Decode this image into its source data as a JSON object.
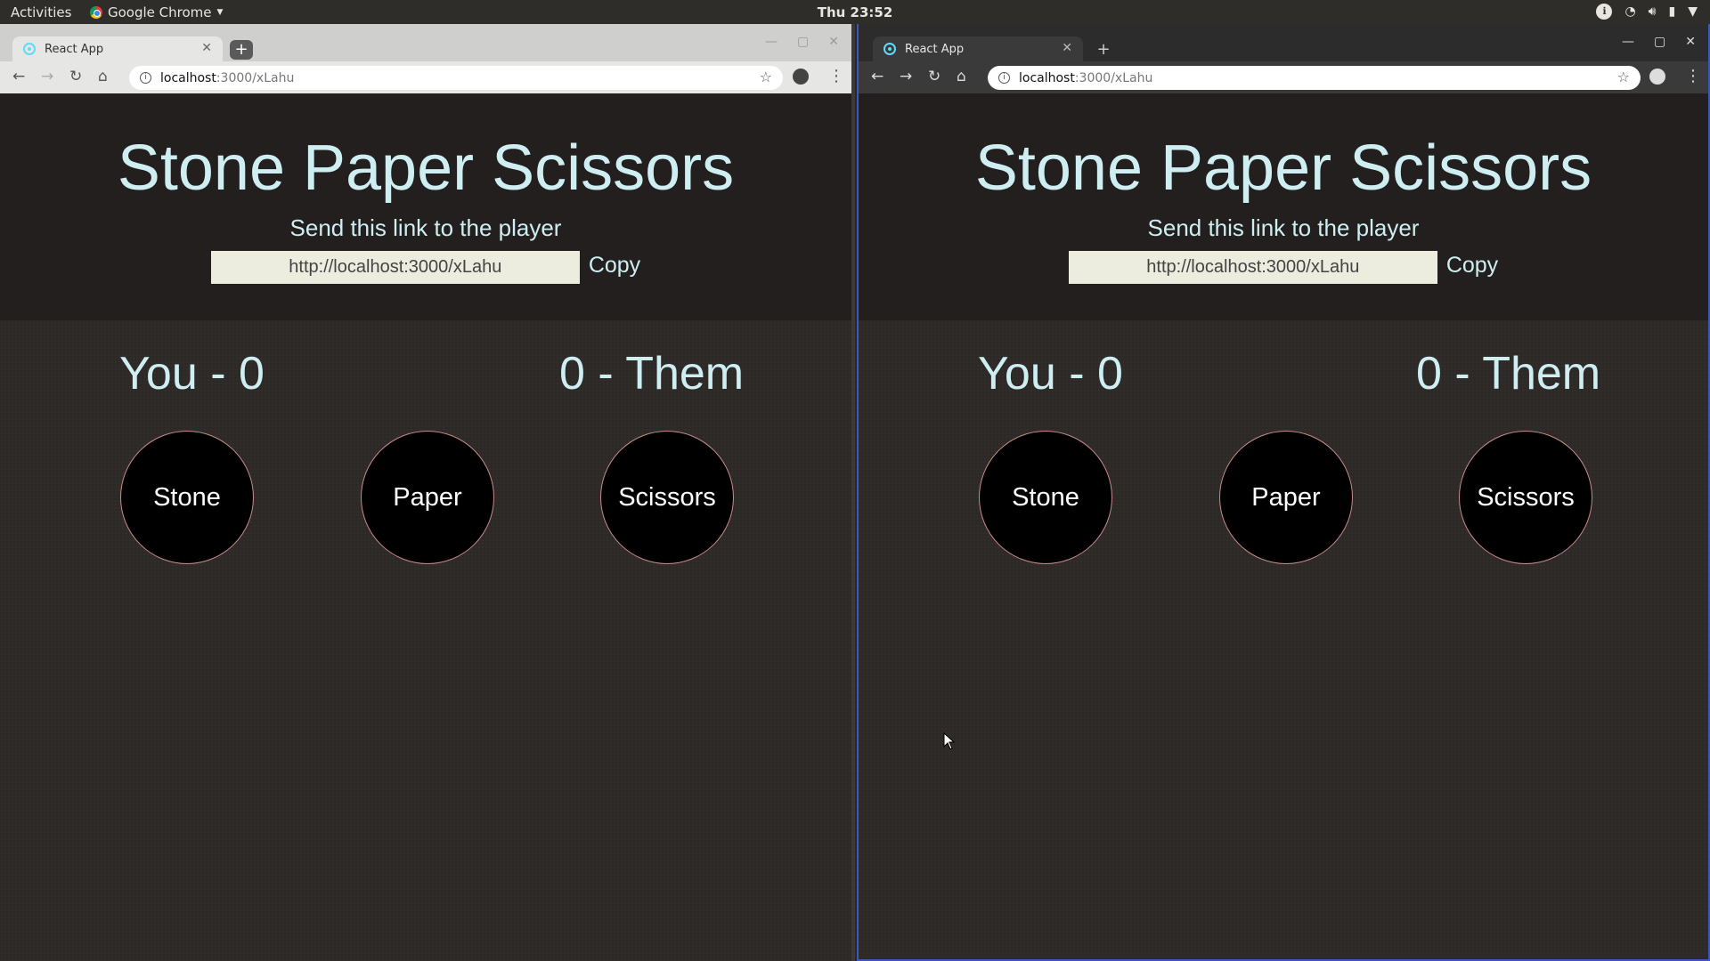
{
  "topbar": {
    "activities": "Activities",
    "app_name": "Google Chrome",
    "clock": "Thu 23:52"
  },
  "windows": [
    {
      "tab_title": "React App",
      "url_host": "localhost",
      "url_path": ":3000/xLahu"
    },
    {
      "tab_title": "React App",
      "url_host": "localhost",
      "url_path": ":3000/xLahu"
    }
  ],
  "game": {
    "title": "Stone Paper Scissors",
    "subtitle": "Send this link to the player",
    "share_link": "http://localhost:3000/xLahu",
    "copy_label": "Copy",
    "score_you": "You - 0",
    "score_them": "0 - Them",
    "choices": [
      "Stone",
      "Paper",
      "Scissors"
    ]
  },
  "colors": {
    "accent_text": "#cfeef2",
    "header_bg": "#221f1e",
    "page_bg": "#2d2927",
    "active_window_border": "#3d57b8"
  }
}
